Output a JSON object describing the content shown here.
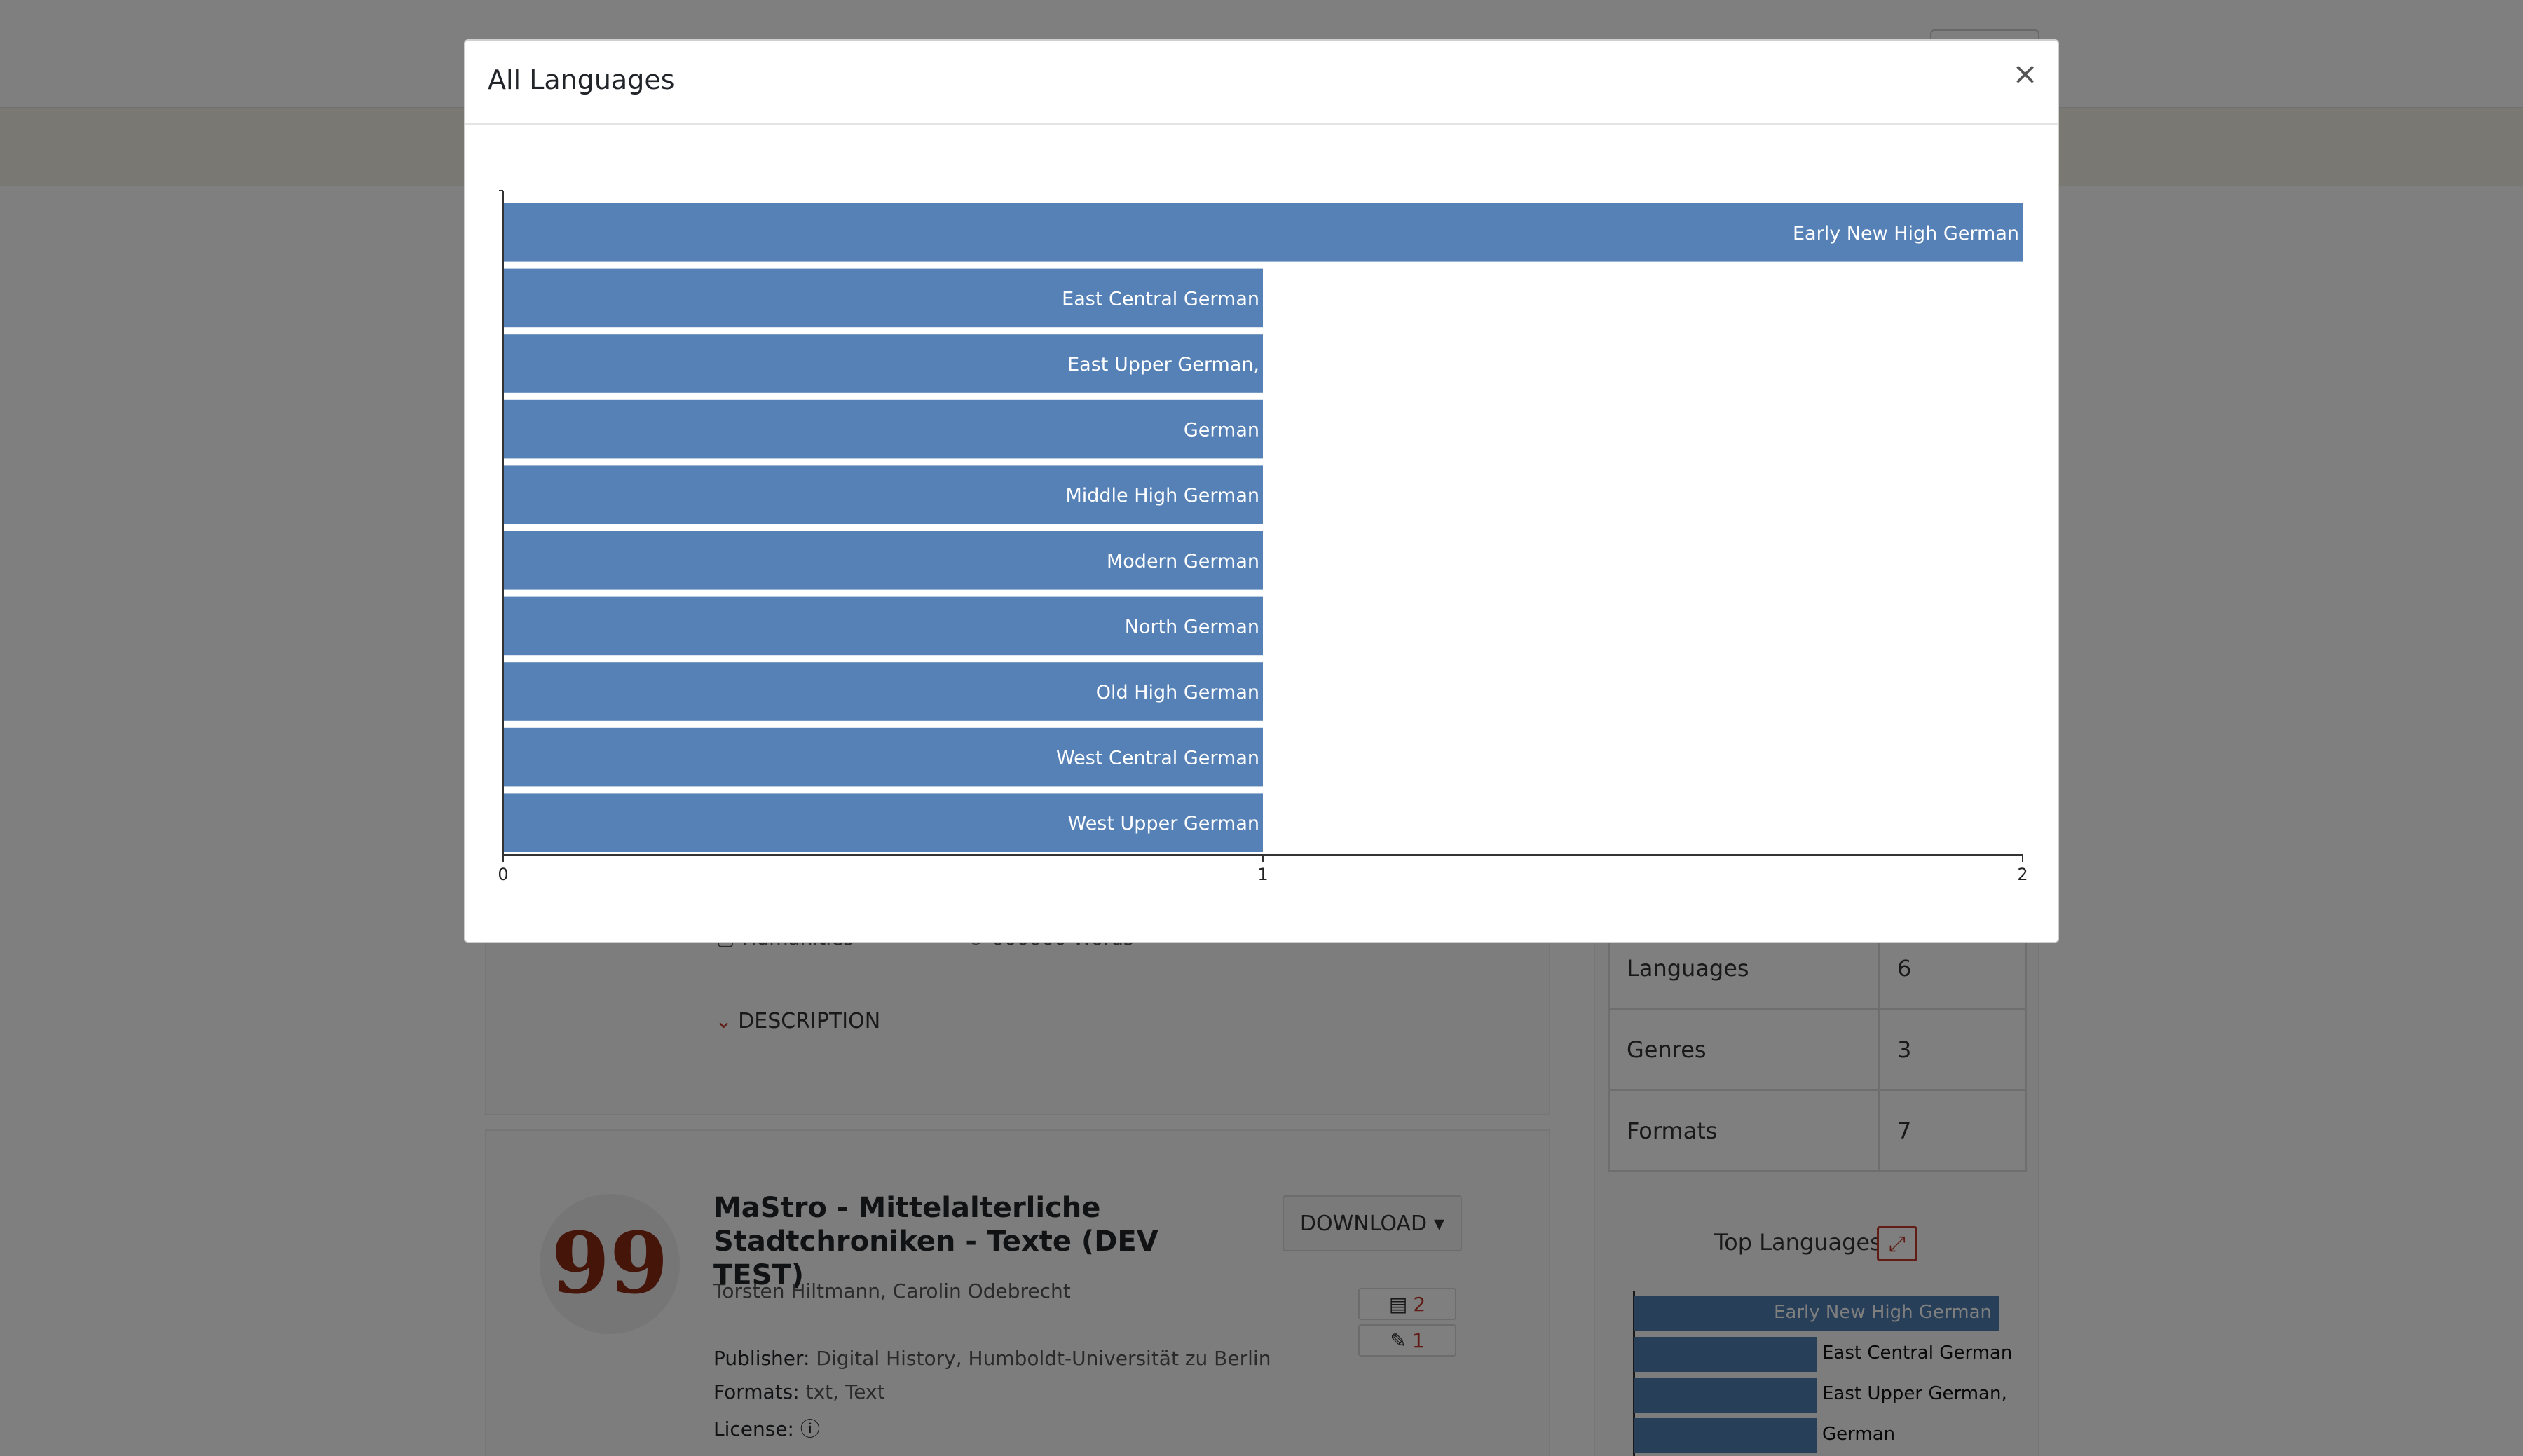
{
  "modal": {
    "title": "All Languages",
    "close_label": "×"
  },
  "chart_data": {
    "type": "bar",
    "orientation": "horizontal",
    "categories": [
      "Early New High German",
      "East Central German",
      "East Upper German,",
      "German",
      "Middle High German",
      "Modern German",
      "North German",
      "Old High German",
      "West Central German",
      "West Upper German"
    ],
    "values": [
      2,
      1,
      1,
      1,
      1,
      1,
      1,
      1,
      1,
      1
    ],
    "xlim": [
      0,
      2
    ],
    "x_ticks": [
      "0",
      "1",
      "2"
    ],
    "bar_color": "#5581b6",
    "label_color": "#ffffff",
    "grid": false
  },
  "background": {
    "meta_left": "Humanities",
    "meta_right": "000000 Words",
    "description_toggle": "DESCRIPTION",
    "stats": [
      {
        "label": "Languages",
        "value": "6"
      },
      {
        "label": "Genres",
        "value": "3"
      },
      {
        "label": "Formats",
        "value": "7"
      }
    ],
    "top_languages_title": "Top Languages",
    "top_languages": [
      "Early New High German",
      "East Central German",
      "East Upper German,",
      "German"
    ],
    "resource": {
      "title": "MaStro - Mittelalterliche Stadtchroniken - Texte (DEV TEST)",
      "authors": "Torsten Hiltmann, Carolin Odebrecht",
      "publisher_label": "Publisher:",
      "publisher_value": "Digital History, Humboldt-Universität zu Berlin",
      "formats_label": "Formats:",
      "formats_value": "txt, Text",
      "license_label": "License:",
      "download_label": "DOWNLOAD",
      "files_count": "2",
      "annotations_count": "1",
      "quote_glyph": "99"
    },
    "colors": {
      "accent": "#c0392b",
      "bar": "#4f7eb3"
    }
  }
}
